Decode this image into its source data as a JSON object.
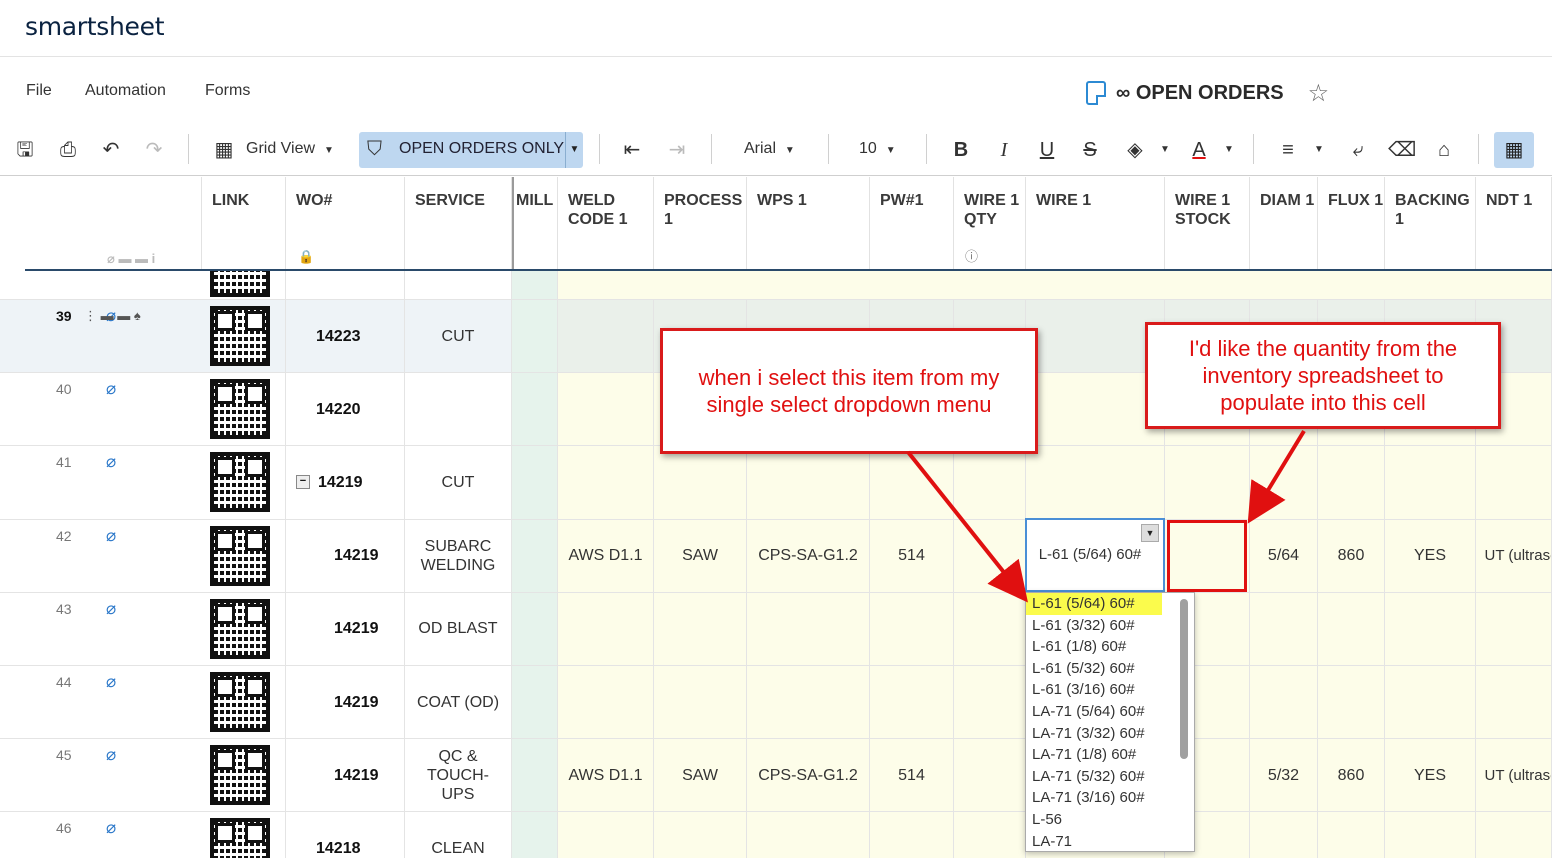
{
  "app": {
    "logo": "smartsheet"
  },
  "menu": [
    "File",
    "Automation",
    "Forms"
  ],
  "sheet": {
    "title": "∞ OPEN ORDERS"
  },
  "toolbar": {
    "view_label": "Grid View",
    "filter_label": "OPEN ORDERS ONLY",
    "font_label": "Arial",
    "size_label": "10"
  },
  "columns": [
    "LINK",
    "WO#",
    "SERVICE",
    "MILL",
    "WELD CODE 1",
    "PROCESS 1",
    "WPS 1",
    "PW#1",
    "WIRE 1 QTY",
    "WIRE 1",
    "WIRE 1 STOCK",
    "DIAM 1",
    "FLUX 1",
    "BACKING 1",
    "NDT 1"
  ],
  "rows": [
    {
      "num": "39",
      "wo": "14223",
      "service": "CUT",
      "weld": "",
      "process": "",
      "wps": "",
      "pw": "",
      "wire": "",
      "diam": "",
      "flux": "",
      "backing": "",
      "ndt": ""
    },
    {
      "num": "40",
      "wo": "14220",
      "service": "",
      "weld": "",
      "process": "",
      "wps": "",
      "pw": "",
      "wire": "",
      "diam": "",
      "flux": "",
      "backing": "",
      "ndt": ""
    },
    {
      "num": "41",
      "wo": "14219",
      "service": "CUT",
      "weld": "",
      "process": "",
      "wps": "",
      "pw": "",
      "wire": "",
      "diam": "",
      "flux": "",
      "backing": "",
      "ndt": ""
    },
    {
      "num": "42",
      "wo": "14219",
      "service": "SUBARC WELDING",
      "weld": "AWS D1.1",
      "process": "SAW",
      "wps": "CPS-SA-G1.2",
      "pw": "514",
      "wire": "L-61 (5/64) 60#",
      "diam": "5/64",
      "flux": "860",
      "backing": "YES",
      "ndt": "UT (ultrason"
    },
    {
      "num": "43",
      "wo": "14219",
      "service": "OD BLAST",
      "weld": "",
      "process": "",
      "wps": "",
      "pw": "",
      "wire": "",
      "diam": "",
      "flux": "",
      "backing": "",
      "ndt": ""
    },
    {
      "num": "44",
      "wo": "14219",
      "service": "COAT (OD)",
      "weld": "",
      "process": "",
      "wps": "",
      "pw": "",
      "wire": "",
      "diam": "",
      "flux": "",
      "backing": "",
      "ndt": ""
    },
    {
      "num": "45",
      "wo": "14219",
      "service": "QC & TOUCH-UPS",
      "weld": "AWS D1.1",
      "process": "SAW",
      "wps": "CPS-SA-G1.2",
      "pw": "514",
      "wire": "",
      "diam": "5/32",
      "flux": "860",
      "backing": "YES",
      "ndt": "UT (ultrason"
    },
    {
      "num": "46",
      "wo": "14218",
      "service": "CLEAN",
      "weld": "",
      "process": "",
      "wps": "",
      "pw": "",
      "wire": "",
      "diam": "",
      "flux": "",
      "backing": "",
      "ndt": ""
    }
  ],
  "dropdown": {
    "options": [
      "L-61 (5/64) 60#",
      "L-61 (3/32) 60#",
      "L-61 (1/8) 60#",
      "L-61 (5/32) 60#",
      "L-61 (3/16) 60#",
      "LA-71 (5/64) 60#",
      "LA-71 (3/32) 60#",
      "LA-71 (1/8) 60#",
      "LA-71 (5/32) 60#",
      "LA-71 (3/16) 60#",
      "L-56",
      "LA-71"
    ],
    "highlighted": "L-61 (5/64) 60#"
  },
  "annotations": {
    "left": "when i select this item from my single select dropdown menu",
    "right": "I'd like the quantity from the inventory spreadsheet to populate into this cell"
  },
  "colors": {
    "accent": "#2c8ad3",
    "annotation": "#e01010",
    "highlight": "#fbfb4c",
    "row_yellow": "#fdfde9"
  }
}
